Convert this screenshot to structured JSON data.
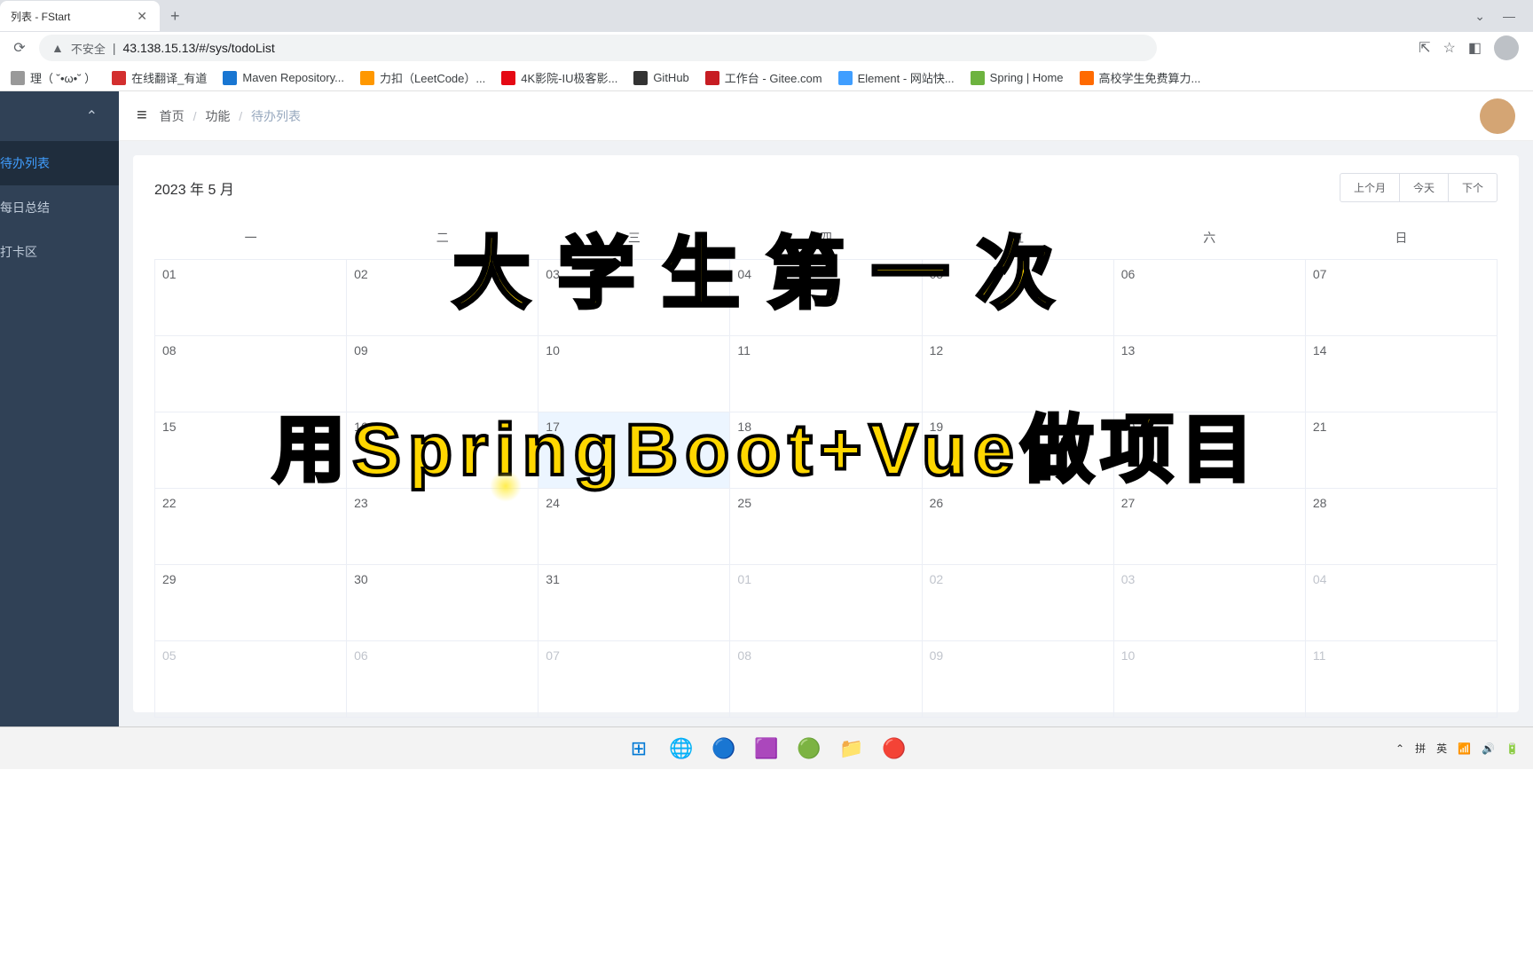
{
  "browser": {
    "tab_title": "列表 - FStart",
    "url_prefix": "不安全",
    "url": "43.138.15.13/#/sys/todoList"
  },
  "bookmarks": [
    {
      "label": "理（ ˘•ω•˘ ）",
      "color": "#999"
    },
    {
      "label": "在线翻译_有道",
      "color": "#d32f2f"
    },
    {
      "label": "Maven Repository...",
      "color": "#1976d2"
    },
    {
      "label": "力扣（LeetCode）...",
      "color": "#ff9800"
    },
    {
      "label": "4K影院-IU极客影...",
      "color": "#e50914"
    },
    {
      "label": "GitHub",
      "color": "#333"
    },
    {
      "label": "工作台 - Gitee.com",
      "color": "#c71d23"
    },
    {
      "label": "Element - 网站快...",
      "color": "#409eff"
    },
    {
      "label": "Spring | Home",
      "color": "#6db33f"
    },
    {
      "label": "高校学生免费算力...",
      "color": "#ff6a00"
    }
  ],
  "sidebar": {
    "items": [
      {
        "label": "待办列表",
        "active": true
      },
      {
        "label": "每日总结",
        "active": false
      },
      {
        "label": "打卡区",
        "active": false
      }
    ]
  },
  "breadcrumb": {
    "home": "首页",
    "func": "功能",
    "current": "待办列表"
  },
  "calendar": {
    "title": "2023 年 5 月",
    "prev": "上个月",
    "today": "今天",
    "next": "下个",
    "weekdays": [
      "一",
      "二",
      "三",
      "四",
      "五",
      "六",
      "日"
    ],
    "rows": [
      [
        {
          "d": "01"
        },
        {
          "d": "02"
        },
        {
          "d": "03"
        },
        {
          "d": "04"
        },
        {
          "d": "05"
        },
        {
          "d": "06"
        },
        {
          "d": "07"
        }
      ],
      [
        {
          "d": "08"
        },
        {
          "d": "09"
        },
        {
          "d": "10"
        },
        {
          "d": "11"
        },
        {
          "d": "12"
        },
        {
          "d": "13"
        },
        {
          "d": "14"
        }
      ],
      [
        {
          "d": "15"
        },
        {
          "d": "16"
        },
        {
          "d": "17",
          "sel": true
        },
        {
          "d": "18"
        },
        {
          "d": "19"
        },
        {
          "d": "20"
        },
        {
          "d": "21"
        }
      ],
      [
        {
          "d": "22"
        },
        {
          "d": "23"
        },
        {
          "d": "24"
        },
        {
          "d": "25"
        },
        {
          "d": "26"
        },
        {
          "d": "27"
        },
        {
          "d": "28"
        }
      ],
      [
        {
          "d": "29"
        },
        {
          "d": "30"
        },
        {
          "d": "31"
        },
        {
          "d": "01",
          "other": true
        },
        {
          "d": "02",
          "other": true
        },
        {
          "d": "03",
          "other": true
        },
        {
          "d": "04",
          "other": true
        }
      ],
      [
        {
          "d": "05",
          "other": true
        },
        {
          "d": "06",
          "other": true
        },
        {
          "d": "07",
          "other": true
        },
        {
          "d": "08",
          "other": true
        },
        {
          "d": "09",
          "other": true
        },
        {
          "d": "10",
          "other": true
        },
        {
          "d": "11",
          "other": true
        }
      ]
    ]
  },
  "overlay": {
    "line1": "大学生第一次",
    "line2": "用SpringBoot+Vue做项目"
  },
  "tray": {
    "ime1": "拼",
    "ime2": "英"
  }
}
